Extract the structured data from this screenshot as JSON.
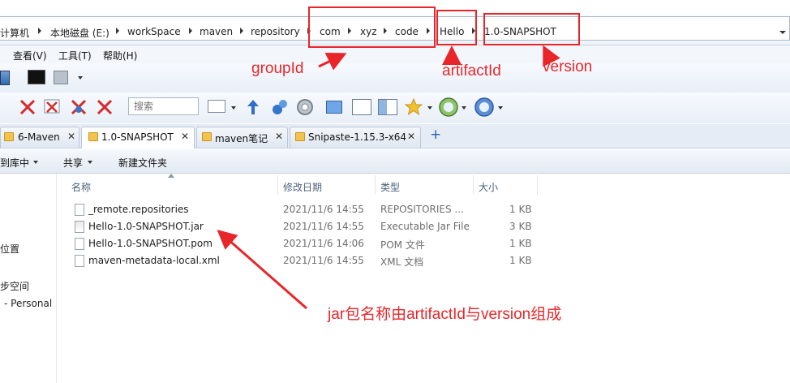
{
  "breadcrumb": [
    "计算机",
    "本地磁盘 (E:)",
    "workSpace",
    "maven",
    "repository",
    "com",
    "xyz",
    "code",
    "Hello",
    "1.0-SNAPSHOT"
  ],
  "menu": [
    "查看(V)",
    "工具(T)",
    "帮助(H)"
  ],
  "search": {
    "placeholder": "搜索"
  },
  "tabs": [
    {
      "label": "6-Maven"
    },
    {
      "label": "1.0-SNAPSHOT"
    },
    {
      "label": "maven笔记"
    },
    {
      "label": "Snipaste-1.15.3-x64"
    }
  ],
  "tab_close": "✕",
  "tab_add": "+",
  "commands": [
    "到库中",
    "共享",
    "新建文件夹"
  ],
  "nav": [
    "位置",
    "步空间",
    "- Personal"
  ],
  "columns": {
    "name": "名称",
    "modified": "修改日期",
    "type": "类型",
    "size": "大小"
  },
  "files": [
    {
      "name": "_remote.repositories",
      "modified": "2021/11/6 14:55",
      "type": "REPOSITORIES ...",
      "size": "1 KB"
    },
    {
      "name": "Hello-1.0-SNAPSHOT.jar",
      "modified": "2021/11/6 14:55",
      "type": "Executable Jar File",
      "size": "3 KB"
    },
    {
      "name": "Hello-1.0-SNAPSHOT.pom",
      "modified": "2021/11/6 14:06",
      "type": "POM 文件",
      "size": "1 KB"
    },
    {
      "name": "maven-metadata-local.xml",
      "modified": "2021/11/6 14:55",
      "type": "XML 文档",
      "size": "1 KB"
    }
  ],
  "annotations": {
    "groupId": "groupId",
    "artifactId": "artifactId",
    "version": "version",
    "note": "jar包名称由artifactId与version组成"
  },
  "colors": {
    "annotation": "#e8262a",
    "folder": "#f2c44d"
  },
  "icons": [
    "cmd-icon",
    "delete-icon",
    "up-arrow-icon",
    "gear-icon",
    "star-icon",
    "globe-icon",
    "layout-icon"
  ]
}
